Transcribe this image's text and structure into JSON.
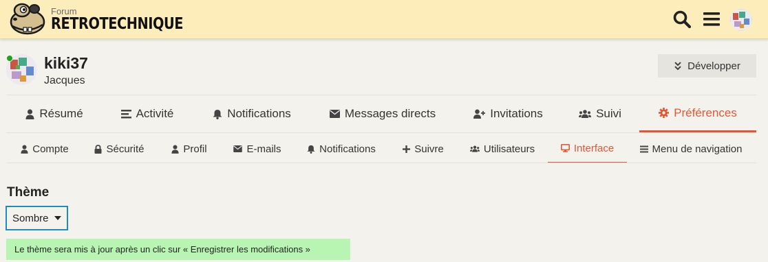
{
  "header": {
    "brand_small": "Forum",
    "brand_big": "RETROTECHNIQUE",
    "icons": [
      "search-icon",
      "hamburger-menu-icon"
    ]
  },
  "user": {
    "username": "kiki37",
    "real_name": "Jacques",
    "status": "online",
    "expand_label": "Développer"
  },
  "main_tabs": [
    {
      "label": "Résumé",
      "icon": "user-icon"
    },
    {
      "label": "Activité",
      "icon": "list-icon"
    },
    {
      "label": "Notifications",
      "icon": "bell-icon"
    },
    {
      "label": "Messages directs",
      "icon": "envelope-icon"
    },
    {
      "label": "Invitations",
      "icon": "user-plus-icon"
    },
    {
      "label": "Suivi",
      "icon": "users-icon"
    },
    {
      "label": "Préférences",
      "icon": "gear-icon",
      "active": true
    }
  ],
  "sub_tabs": [
    {
      "label": "Compte",
      "icon": "user-icon"
    },
    {
      "label": "Sécurité",
      "icon": "lock-icon"
    },
    {
      "label": "Profil",
      "icon": "user-icon"
    },
    {
      "label": "E-mails",
      "icon": "envelope-icon"
    },
    {
      "label": "Notifications",
      "icon": "bell-icon"
    },
    {
      "label": "Suivre",
      "icon": "plus-icon"
    },
    {
      "label": "Utilisateurs",
      "icon": "users-icon"
    },
    {
      "label": "Interface",
      "icon": "desktop-icon",
      "active": true
    },
    {
      "label": "Menu de navigation",
      "icon": "bars-icon"
    }
  ],
  "content": {
    "section_title": "Thème",
    "theme_value": "Sombre",
    "notice": "Le thème sera mis à jour après un clic sur « Enregistrer les modifications »"
  },
  "colors": {
    "header_bg": "#fcedbb",
    "page_bg": "#f4f2ed",
    "accent": "#e45735",
    "focus": "#1b8ac7",
    "notice_bg": "#b8f5b2",
    "online": "#1ca51c"
  }
}
